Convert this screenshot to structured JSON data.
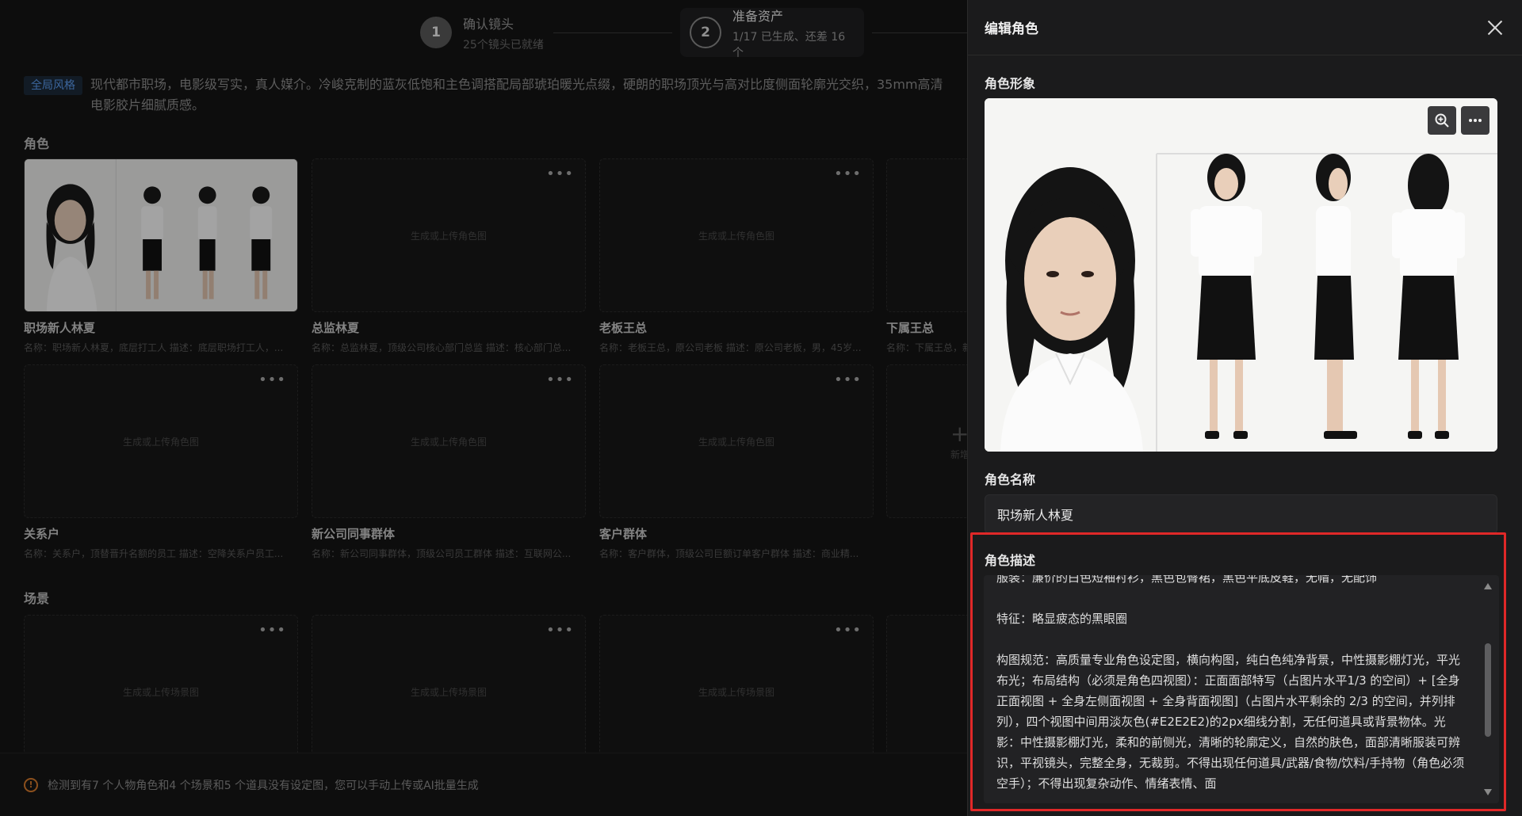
{
  "stepper": {
    "steps": [
      {
        "num": "1",
        "title": "确认镜头",
        "sub": "25个镜头已就绪"
      },
      {
        "num": "2",
        "title": "准备资产",
        "sub": "1/17 已生成、还差 16 个"
      }
    ]
  },
  "global_style": {
    "tag": "全局风格",
    "text": "现代都市职场，电影级写实，真人媒介。冷峻克制的蓝灰低饱和主色调搭配局部琥珀暖光点缀，硬朗的职场顶光与高对比度侧面轮廓光交织，35mm高清电影胶片细腻质感。"
  },
  "roles": {
    "title": "角色",
    "placeholder": "生成或上传角色图",
    "add_label": "新增",
    "items": [
      {
        "name": "职场新人林夏",
        "desc": "名称：职场新人林夏，底层打工人 描述：底层职场打工人，...",
        "filled": true
      },
      {
        "name": "总监林夏",
        "desc": "名称：总监林夏，顶级公司核心部门总监 描述：核心部门总..."
      },
      {
        "name": "老板王总",
        "desc": "名称：老板王总，原公司老板 描述：原公司老板，男，45岁..."
      },
      {
        "name": "下属王总",
        "desc": "名称：下属王总，新..."
      },
      {
        "name": "关系户",
        "desc": "名称：关系户，顶替晋升名额的员工 描述：空降关系户员工..."
      },
      {
        "name": "新公司同事群体",
        "desc": "名称：新公司同事群体，顶级公司员工群体 描述：互联网公..."
      },
      {
        "name": "客户群体",
        "desc": "名称：客户群体，顶级公司巨额订单客户群体 描述：商业精..."
      }
    ]
  },
  "scenes": {
    "title": "场景",
    "placeholder": "生成或上传场景图"
  },
  "notice": {
    "icon": "warning-icon",
    "text": "检测到有7 个人物角色和4 个场景和5 个道具没有设定图，您可以手动上传或AI批量生成"
  },
  "drawer": {
    "title": "编辑角色",
    "image_label": "角色形象",
    "name_label": "角色名称",
    "name_value": "职场新人林夏",
    "desc_label": "角色描述",
    "desc_text": "服装：廉价的白色短袖衬衫，黑色包臀裙，黑色平底皮鞋，无帽，无配饰\n\n特征：略显疲态的黑眼圈\n\n构图规范：高质量专业角色设定图，横向构图，纯白色纯净背景，中性摄影棚灯光，平光布光；布局结构（必须是角色四视图）：正面面部特写（占图片水平1/3 的空间）+ [全身正面视图 + 全身左侧面视图 + 全身背面视图]（占图片水平剩余的 2/3 的空间，并列排列），四个视图中间用淡灰色(#E2E2E2)的2px细线分割，无任何道具或背景物体。光影：中性摄影棚灯光，柔和的前侧光，清晰的轮廓定义，自然的肤色，面部清晰服装可辨识，平视镜头，完整全身，无裁剪。不得出现任何道具/武器/食物/饮料/手持物（角色必须空手）；不得出现复杂动作、情绪表情、面"
  },
  "colors": {
    "accent_tag": "#5b9cf0",
    "highlight": "#e02828",
    "warning": "#d77b2d"
  }
}
